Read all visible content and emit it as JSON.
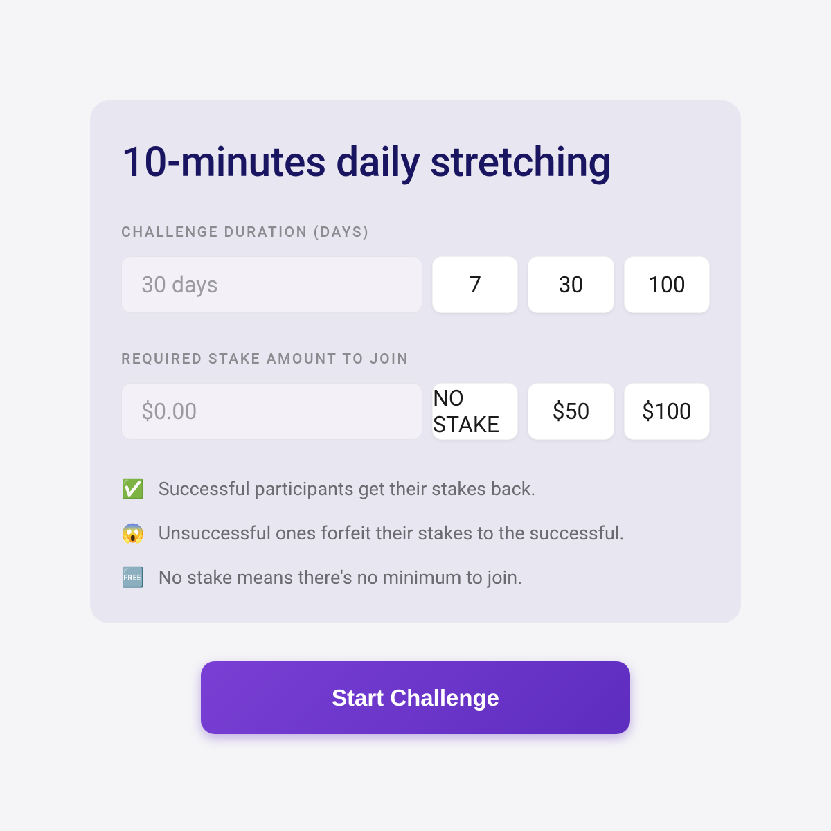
{
  "challenge": {
    "title": "10-minutes daily stretching"
  },
  "duration": {
    "label": "CHALLENGE DURATION (DAYS)",
    "input_placeholder": "30 days",
    "options": [
      "7",
      "30",
      "100"
    ]
  },
  "stake": {
    "label": "REQUIRED STAKE AMOUNT TO JOIN",
    "input_placeholder": "$0.00",
    "options": [
      "NO STAKE",
      "$50",
      "$100"
    ]
  },
  "info": [
    {
      "emoji": "✅",
      "text": "Successful participants get their stakes back."
    },
    {
      "emoji": "😱",
      "text": "Unsuccessful ones forfeit their stakes to the successful."
    },
    {
      "emoji": "🆓",
      "text": "No stake means there's no minimum to join."
    }
  ],
  "cta": {
    "label": "Start Challenge"
  }
}
